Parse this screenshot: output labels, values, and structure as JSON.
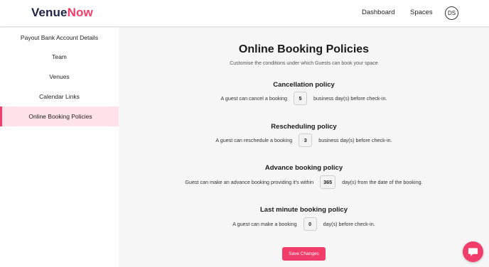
{
  "brand": {
    "part1": "Venue",
    "part2": "Now"
  },
  "nav": {
    "dashboard": "Dashboard",
    "spaces": "Spaces",
    "avatar_initials": "DS"
  },
  "sidebar": {
    "items": [
      {
        "label": "Payout Bank Account Details",
        "active": false
      },
      {
        "label": "Team",
        "active": false
      },
      {
        "label": "Venues",
        "active": false
      },
      {
        "label": "Calendar Links",
        "active": false
      },
      {
        "label": "Online Booking Policies",
        "active": true
      }
    ]
  },
  "main": {
    "title": "Online Booking Policies",
    "subtitle": "Customise the conditions under which Guests can book your space",
    "policies": [
      {
        "title": "Cancellation policy",
        "prefix": "A guest can cancel a booking",
        "value": "5",
        "suffix": "business day(s) before check-in."
      },
      {
        "title": "Rescheduling policy",
        "prefix": "A guest can reschedule a booking",
        "value": "3",
        "suffix": "business day(s) before check-in."
      },
      {
        "title": "Advance booking policy",
        "prefix": "Guest can make an advance booking providing it's within",
        "value": "365",
        "suffix": "day(s) from the date of the booking."
      },
      {
        "title": "Last minute booking policy",
        "prefix": "A guest can make a booking",
        "value": "0",
        "suffix": "day(s) before check-in."
      }
    ],
    "save_label": "Save Changes"
  },
  "colors": {
    "brand_pink": "#f23d6a",
    "brand_navy": "#1c2447",
    "active_bg": "#fde2ea"
  },
  "icons": {
    "chat": "chat-bubble-icon"
  }
}
